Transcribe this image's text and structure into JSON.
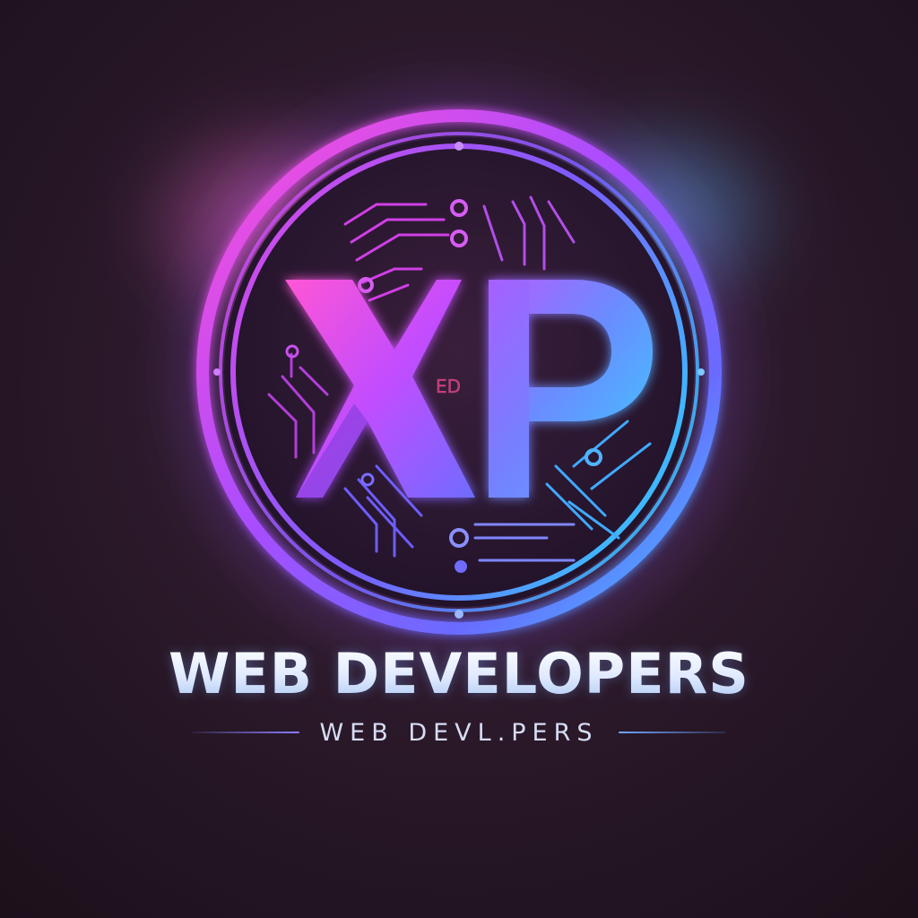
{
  "logo": {
    "monogram": "XP",
    "tiny_mark": "ED",
    "title": "WEB DEVELOPERS",
    "subtitle": "WEB DEVL.PERS"
  },
  "colors": {
    "background": "#2a1828",
    "ring_start": "#ff4fd8",
    "ring_mid": "#a84dff",
    "ring_end": "#3ec8ff",
    "title_text": "#eef4ff",
    "subtitle_text": "#d6dcf4"
  }
}
